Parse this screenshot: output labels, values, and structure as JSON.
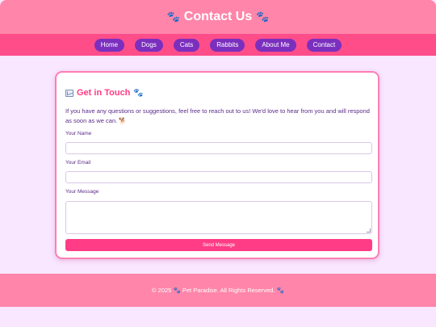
{
  "header": {
    "title": "Contact Us",
    "paw_glyph": "🐾"
  },
  "nav": {
    "items": [
      {
        "label": "Home"
      },
      {
        "label": "Dogs"
      },
      {
        "label": "Cats"
      },
      {
        "label": "Rabbits"
      },
      {
        "label": "About Me"
      },
      {
        "label": "Contact"
      }
    ]
  },
  "contact": {
    "title": "Get in Touch",
    "title_icon": "envelope-icon",
    "intro": "If you have any questions or suggestions, feel free to reach out to us! We'd love to hear from you and will respond as soon as we can. 🐕",
    "fields": {
      "name_label": "Your Name",
      "name_value": "",
      "email_label": "Your Email",
      "email_value": "",
      "message_label": "Your Message",
      "message_value": ""
    },
    "send_label": "Send Message"
  },
  "footer": {
    "text_prefix": "© 2025",
    "text_suffix": "Pet Paradise. All Rights Reserved."
  },
  "colors": {
    "header_bg": "#ff85aa",
    "nav_bg": "#ff4d8a",
    "nav_pill": "#7b2fbe",
    "accent": "#ff3c85",
    "page_bg": "#f9e6ff",
    "text": "#5c2b8a"
  }
}
